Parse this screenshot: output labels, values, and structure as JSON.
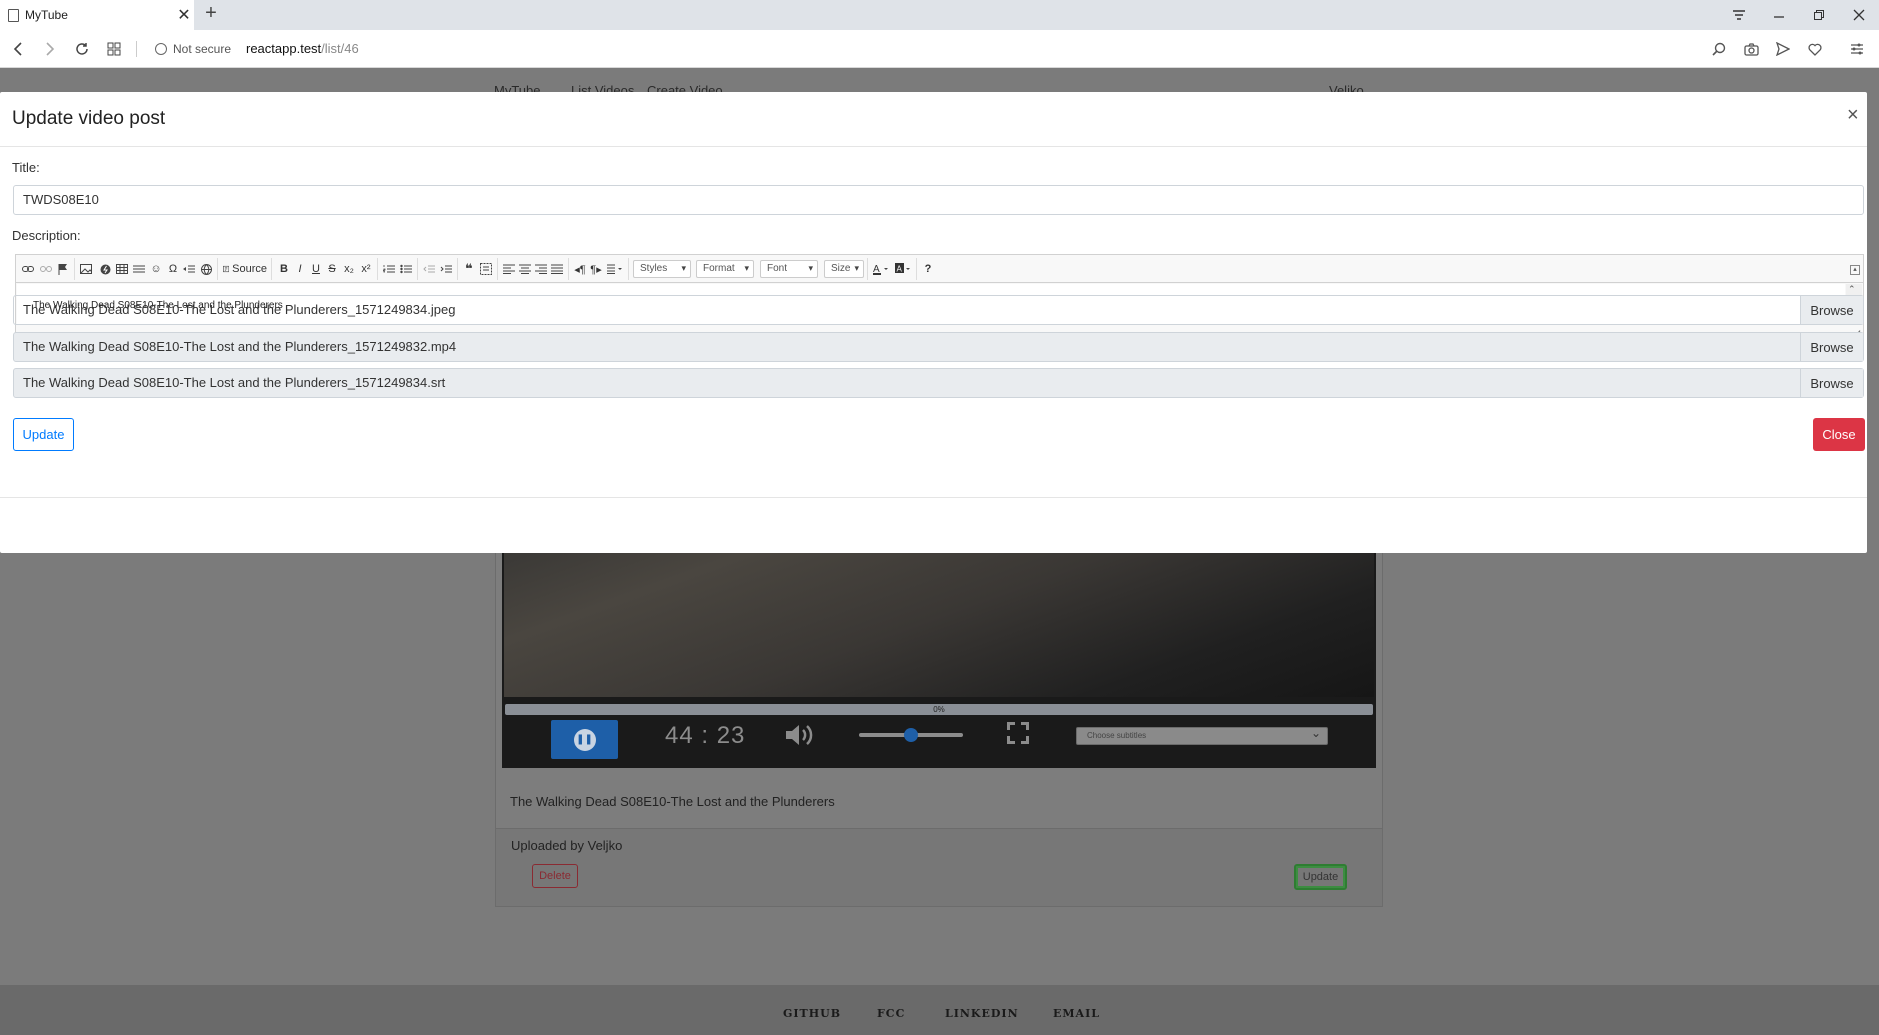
{
  "browser": {
    "tab_title": "MyTube",
    "tab_close": "✕",
    "new_tab": "+",
    "security": "Not secure",
    "url_host": "reactapp.test",
    "url_path": "/list/46"
  },
  "background": {
    "nav_items": [
      "MyTube",
      "List Videos",
      "Create Video",
      "Veljko"
    ],
    "progress_label": "0%",
    "progress_value": 0,
    "time": "44 : 23",
    "volume_level": 0.5,
    "subtitles_placeholder": "Choose subtitles",
    "card_text": "The Walking Dead S08E10-The Lost and the Plunderers",
    "uploaded_by": "Uploaded by Veljko",
    "delete_label": "Delete",
    "update_label": "Update",
    "footer_links": [
      "GITHUB",
      "FCC",
      "LINKEDIN",
      "EMAIL"
    ]
  },
  "modal": {
    "title": "Update video post",
    "close_x": "×",
    "title_label": "Title:",
    "title_value": "TWDS08E10",
    "description_label": "Description:",
    "description_value": "The Walking Dead S08E10-The Lost and the Plunderers",
    "toolbar": {
      "source_label": "Source",
      "styles_label": "Styles",
      "format_label": "Format",
      "font_label": "Font",
      "size_label": "Size",
      "bold": "B",
      "italic": "I",
      "underline": "U",
      "strike": "S",
      "subscript": "x₂",
      "superscript": "x²",
      "help": "?"
    },
    "files": [
      {
        "name": "The Walking Dead S08E10-The Lost and the Plunderers_1571249834.jpeg",
        "browse": "Browse"
      },
      {
        "name": "The Walking Dead S08E10-The Lost and the Plunderers_1571249832.mp4",
        "browse": "Browse"
      },
      {
        "name": "The Walking Dead S08E10-The Lost and the Plunderers_1571249834.srt",
        "browse": "Browse"
      }
    ],
    "update_button": "Update",
    "close_button": "Close"
  },
  "colors": {
    "primary": "#007bff",
    "danger": "#dc3545",
    "player_blue": "#1e5fa8",
    "success": "#2e7d32"
  }
}
